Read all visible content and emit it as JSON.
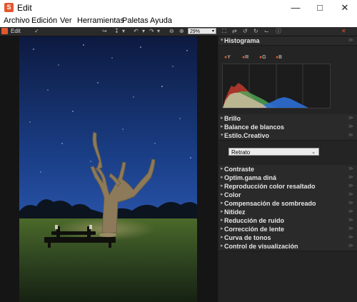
{
  "window": {
    "title": "Edit",
    "app_icon": "app-logo-icon",
    "controls": [
      "minimize-icon",
      "maximize-icon",
      "close-icon"
    ]
  },
  "menu": [
    "Archivo",
    "Edición",
    "Ver",
    "Herramientas",
    "Paletas",
    "Ayuda"
  ],
  "toolbar": {
    "edit_label": "Edit",
    "zoom": "29%"
  },
  "panel": {
    "histogram": {
      "title": "Histograma",
      "channels": [
        "Y",
        "R",
        "G",
        "B"
      ]
    },
    "sections_top": [
      "Brillo",
      "Balance de blancos",
      "Estilo.Creativo"
    ],
    "creative_style_value": "Retrato",
    "sections_bottom": [
      "Contraste",
      "Optim.gama diná",
      "Reproducción color resaltado",
      "Color",
      "Compensación de sombreado",
      "Nitidez",
      "Reducción de ruido",
      "Corrección de lente",
      "Curva de tonos",
      "Control de visualización"
    ]
  },
  "colors": {
    "accent": "#e4572e",
    "panel_bg": "#232323",
    "header_bg": "#2a2a2a"
  }
}
